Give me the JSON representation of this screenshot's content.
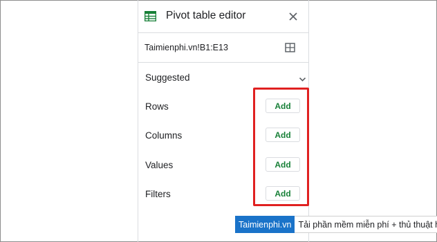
{
  "panel": {
    "title": "Pivot table editor",
    "range": "Taimienphi.vn!B1:E13"
  },
  "sections": {
    "suggested": "Suggested",
    "rows": "Rows",
    "columns": "Columns",
    "values": "Values",
    "filters": "Filters"
  },
  "buttons": {
    "add_rows": "Add",
    "add_columns": "Add",
    "add_values": "Add",
    "add_filters": "Add"
  },
  "icons": {
    "title": "sheets-table-icon",
    "close": "close-icon",
    "range": "grid-icon",
    "expand": "chevron-down-icon"
  },
  "colors": {
    "accent_green": "#188038",
    "highlight_red": "#e02020",
    "watermark_blue": "#1a73c9"
  },
  "watermark": {
    "brand": "Taimienphi.vn",
    "tagline": "Tải phần mềm miễn phí + thủ thuật hay"
  }
}
